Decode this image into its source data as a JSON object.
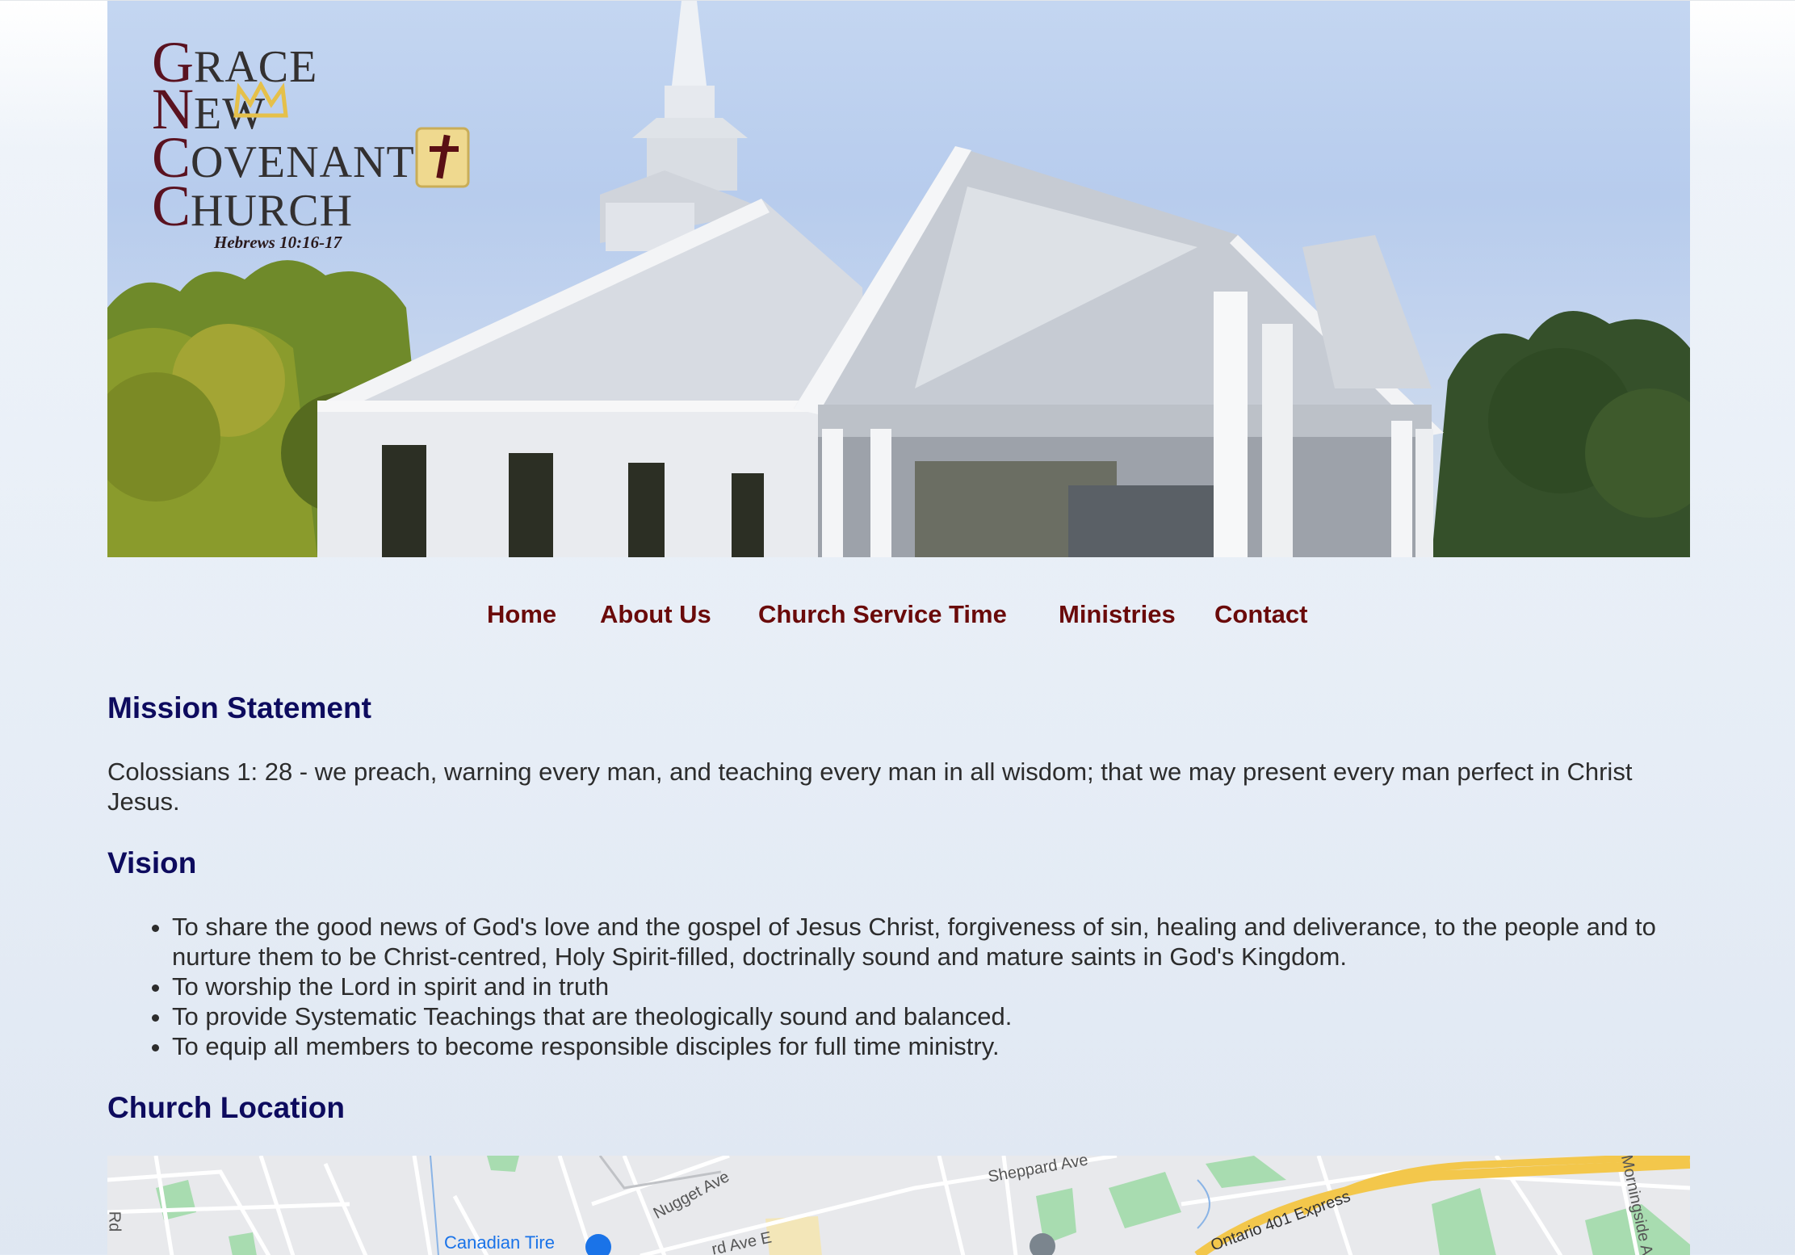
{
  "logo": {
    "line1_initial": "G",
    "line1_rest": "RACE",
    "line2_initial": "N",
    "line2_rest": "EW",
    "line3_initial": "C",
    "line3_rest": "OVENANT",
    "line4_initial": "C",
    "line4_rest": "HURCH",
    "verse": "Hebrews 10:16-17"
  },
  "nav": {
    "items": [
      {
        "label": "Home"
      },
      {
        "label": "About Us"
      },
      {
        "label": "Church Service Time"
      },
      {
        "label": "Ministries"
      },
      {
        "label": "Contact"
      }
    ]
  },
  "mission": {
    "heading": "Mission Statement",
    "text": "Colossians 1: 28 - we preach, warning every man, and teaching every man in all wisdom; that we may present every man perfect in Christ Jesus."
  },
  "vision": {
    "heading": "Vision",
    "items": [
      "To share the good news of God's love and the gospel of Jesus Christ, forgiveness of sin, healing and deliverance, to the people and to nurture them to be Christ-centred, Holy Spirit-filled, doctrinally sound and mature saints in God's Kingdom.",
      "To worship the Lord in spirit and in truth",
      "To provide Systematic Teachings that are theologically sound and balanced.",
      "To equip all members to become responsible disciples for full time ministry."
    ]
  },
  "location": {
    "heading": "Church Location",
    "map_labels": {
      "canadian_tire": "Canadian Tire",
      "nugget_ave": "Nugget Ave",
      "sheppard_ave": "Sheppard Ave",
      "ontario_401": "Ontario 401 Express",
      "morningside": "Morningside A",
      "ave_e": "rd Ave E",
      "rd": "Rd"
    }
  },
  "colors": {
    "nav_link": "#6a0a0a",
    "heading": "#0d0b5e",
    "body_text": "#2c2c2c"
  }
}
